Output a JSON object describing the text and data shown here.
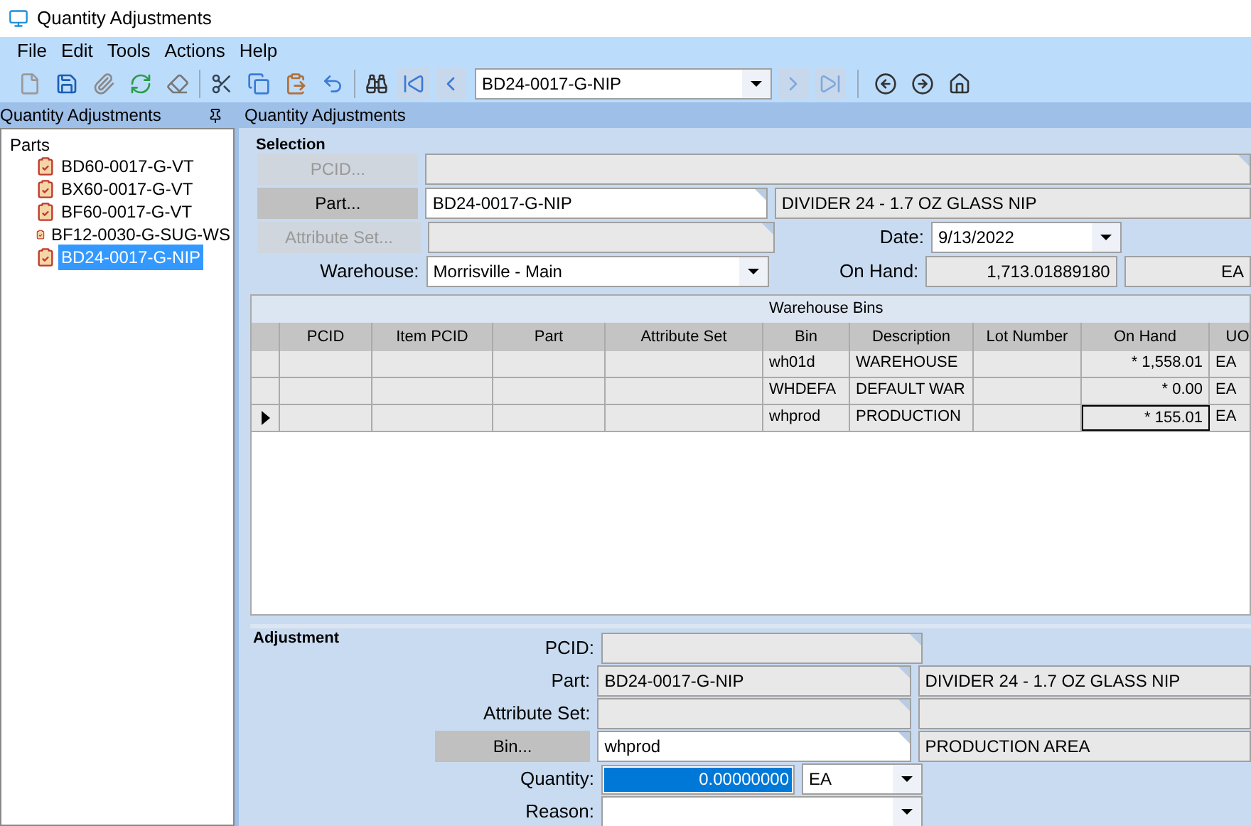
{
  "window": {
    "title": "Quantity Adjustments"
  },
  "menu": [
    "File",
    "Edit",
    "Tools",
    "Actions",
    "Help"
  ],
  "toolbar": {
    "record_selector": "BD24-0017-G-NIP"
  },
  "left_panel": {
    "title": "Quantity Adjustments",
    "tree": {
      "label": "Parts",
      "children": [
        {
          "label": "BD60-0017-G-VT",
          "selected": false
        },
        {
          "label": "BX60-0017-G-VT",
          "selected": false
        },
        {
          "label": "BF60-0017-G-VT",
          "selected": false
        },
        {
          "label": "BF12-0030-G-SUG-WS",
          "selected": false
        },
        {
          "label": "BD24-0017-G-NIP",
          "selected": true
        }
      ]
    }
  },
  "main_panel": {
    "title": "Quantity Adjustments"
  },
  "selection": {
    "title": "Selection",
    "rows": [
      {
        "button": "PCID...",
        "disabled": true,
        "kind": "readonly"
      },
      {
        "button": "Part...",
        "disabled": false,
        "kind": "text",
        "value": "BD24-0017-G-NIP",
        "description": "DIVIDER 24 - 1.7 OZ GLASS NIP"
      },
      {
        "button": "Attribute Set...",
        "disabled": true,
        "kind": "readonly",
        "date_label": "Date:",
        "date_value": "9/13/2022"
      },
      {
        "label": "Warehouse:",
        "kind": "combo",
        "value": "Morrisville - Main",
        "on_hand_label": "On Hand:",
        "on_hand_value": "1,713.01889180",
        "on_hand_uom": "EA"
      }
    ]
  },
  "warehouse_bins": {
    "title": "Warehouse Bins",
    "columns": [
      "PCID",
      "Item PCID",
      "Part",
      "Attribute Set",
      "Bin",
      "Description",
      "Lot Number",
      "On Hand",
      "UO"
    ],
    "rows": [
      {
        "current": false,
        "cells": [
          "",
          "",
          "",
          "",
          "wh01d",
          "WAREHOUSE",
          "",
          "* 1,558.01",
          "EA"
        ]
      },
      {
        "current": false,
        "cells": [
          "",
          "",
          "",
          "",
          "WHDEFA",
          "DEFAULT WAR",
          "",
          "* 0.00",
          "EA"
        ]
      },
      {
        "current": true,
        "cells": [
          "",
          "",
          "",
          "",
          "whprod",
          "PRODUCTION",
          "",
          "* 155.01",
          "EA"
        ]
      }
    ]
  },
  "adjustment": {
    "title": "Adjustment",
    "rows": [
      {
        "label": "PCID:",
        "kind": "readonly"
      },
      {
        "label": "Part:",
        "kind": "readonly",
        "value": "BD24-0017-G-NIP",
        "description": "DIVIDER 24 - 1.7 OZ GLASS NIP"
      },
      {
        "label": "Attribute Set:",
        "kind": "readonly",
        "description_box": true
      },
      {
        "button": "Bin...",
        "kind": "text",
        "value": "whprod",
        "description": "PRODUCTION AREA"
      },
      {
        "label": "Quantity:",
        "kind": "quantity",
        "value": "0.00000000",
        "selected": true,
        "unit": "EA"
      },
      {
        "label": "Reason:",
        "kind": "combo"
      }
    ]
  }
}
